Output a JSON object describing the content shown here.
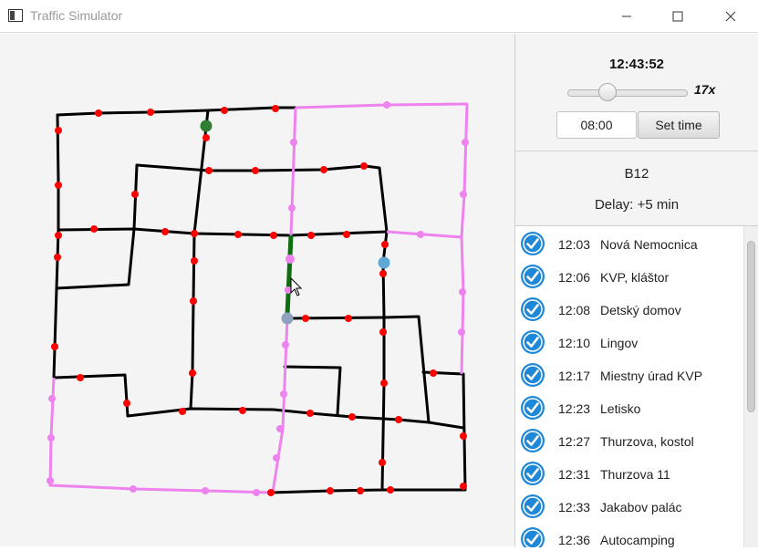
{
  "window": {
    "title": "Traffic Simulator"
  },
  "controls": {
    "clock": "12:43:52",
    "speed_label": "17x",
    "speed_fraction": 0.34,
    "time_input_value": "08:00",
    "set_time_label": "Set time"
  },
  "line_info": {
    "line": "B12",
    "delay": "Delay:  +5 min"
  },
  "stops": [
    {
      "time": "12:03",
      "name": "Nová Nemocnica",
      "passed": true
    },
    {
      "time": "12:06",
      "name": "KVP, kláštor",
      "passed": true
    },
    {
      "time": "12:08",
      "name": "Detský domov",
      "passed": true
    },
    {
      "time": "12:10",
      "name": "Lingov",
      "passed": true
    },
    {
      "time": "12:17",
      "name": "Miestny úrad KVP",
      "passed": true
    },
    {
      "time": "12:23",
      "name": "Letisko",
      "passed": true
    },
    {
      "time": "12:27",
      "name": "Thurzova, kostol",
      "passed": true
    },
    {
      "time": "12:31",
      "name": "Thurzova 11",
      "passed": true
    },
    {
      "time": "12:33",
      "name": "Jakabov palác",
      "passed": true
    },
    {
      "time": "12:36",
      "name": "Autocamping",
      "passed": true
    }
  ],
  "colors": {
    "street": "#000000",
    "route": "#ee82ee",
    "active_segment": "#0c6e0c",
    "stop_dot": "#ff0000",
    "vehicle": "#2e7d32",
    "vehicle_other": "#5ea8d8",
    "check": "#1e88d6"
  }
}
